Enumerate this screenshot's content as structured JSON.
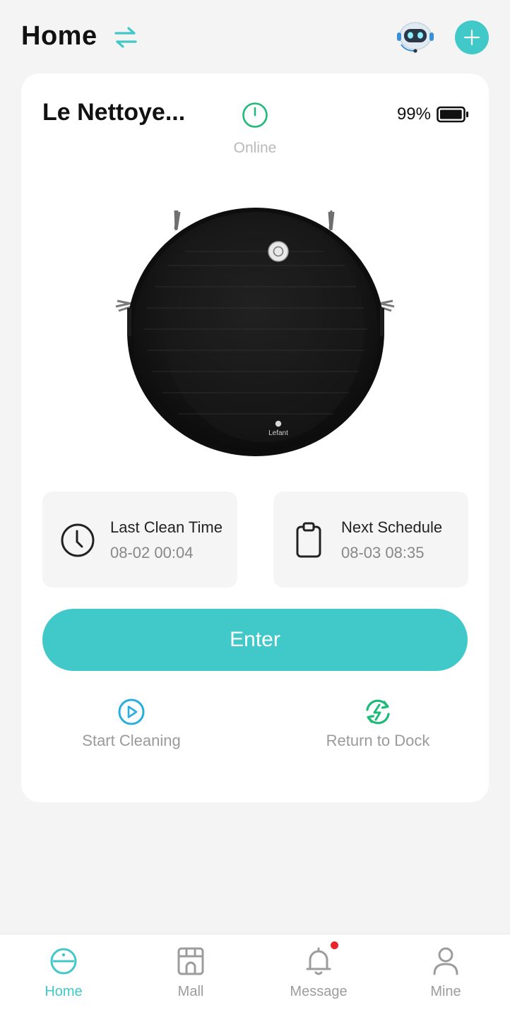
{
  "header": {
    "title": "Home",
    "switch_icon": "swap-arrows-icon",
    "avatar_icon": "robot-assistant-icon",
    "add_icon": "plus-icon"
  },
  "device": {
    "name": "Le Nettoye...",
    "status": "Online",
    "battery": "99%",
    "battery_level": 0.99,
    "brand_mark": "Lefant"
  },
  "stats": [
    {
      "icon": "clock-icon",
      "label": "Last Clean Time",
      "value": "08-02 00:04"
    },
    {
      "icon": "clipboard-icon",
      "label": "Next Schedule",
      "value": "08-03 08:35"
    }
  ],
  "enter_label": "Enter",
  "actions": [
    {
      "icon": "play-icon",
      "label": "Start Cleaning"
    },
    {
      "icon": "recharge-icon",
      "label": "Return to Dock"
    }
  ],
  "tabs": [
    {
      "icon": "robot-vacuum-icon",
      "label": "Home",
      "active": true
    },
    {
      "icon": "store-icon",
      "label": "Mall",
      "active": false
    },
    {
      "icon": "bell-icon",
      "label": "Message",
      "active": false,
      "badge": true
    },
    {
      "icon": "person-icon",
      "label": "Mine",
      "active": false
    }
  ],
  "colors": {
    "accent": "#41c8c8",
    "green": "#1fba7a",
    "blue": "#29aee0",
    "badge": "#e8262b",
    "muted": "#9c9c9c"
  }
}
